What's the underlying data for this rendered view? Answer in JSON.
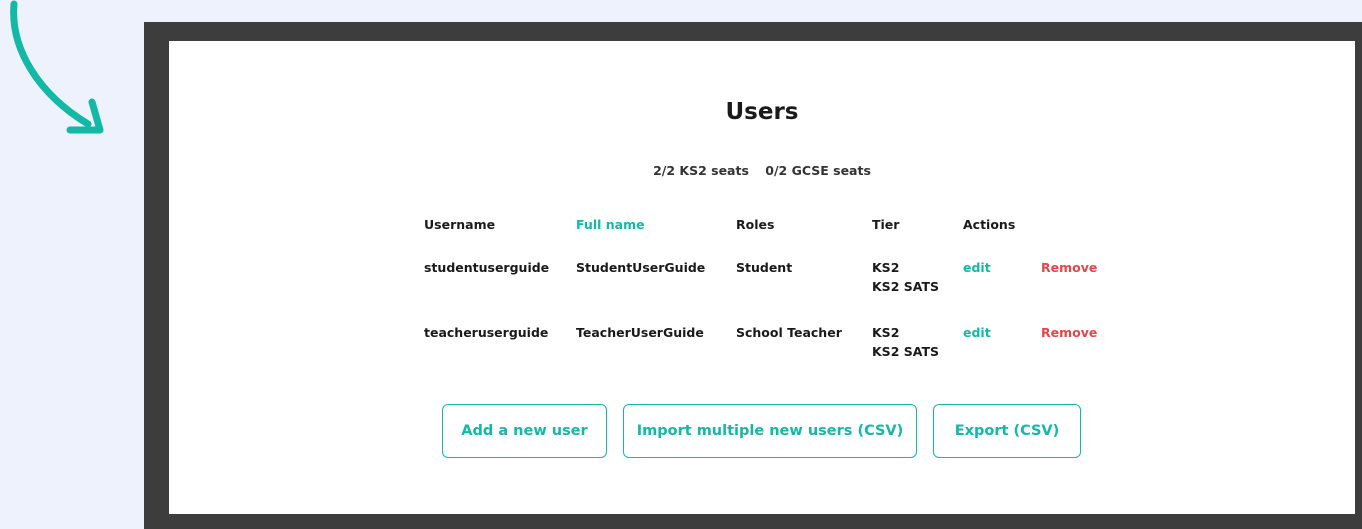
{
  "colors": {
    "accent": "#14b8a6",
    "danger": "#e04848",
    "frame": "#3d3d3d",
    "page_bg": "#eef2fc"
  },
  "decor": {
    "arrow_icon": "curved-arrow-icon"
  },
  "users": {
    "title": "Users",
    "seats": {
      "ks2": "2/2 KS2 seats",
      "gcse": "0/2 GCSE seats"
    },
    "columns": {
      "username": "Username",
      "full_name": "Full name",
      "roles": "Roles",
      "tier": "Tier",
      "actions": "Actions"
    },
    "rows": [
      {
        "username": "studentuserguide",
        "full_name": "StudentUserGuide",
        "role": "Student",
        "tier": [
          "KS2",
          "KS2 SATS"
        ],
        "edit": "edit",
        "remove": "Remove"
      },
      {
        "username": "teacheruserguide",
        "full_name": "TeacherUserGuide",
        "role": "School Teacher",
        "tier": [
          "KS2",
          "KS2 SATS"
        ],
        "edit": "edit",
        "remove": "Remove"
      }
    ],
    "buttons": {
      "add": "Add a new user",
      "import": "Import multiple new users (CSV)",
      "export": "Export (CSV)"
    }
  }
}
